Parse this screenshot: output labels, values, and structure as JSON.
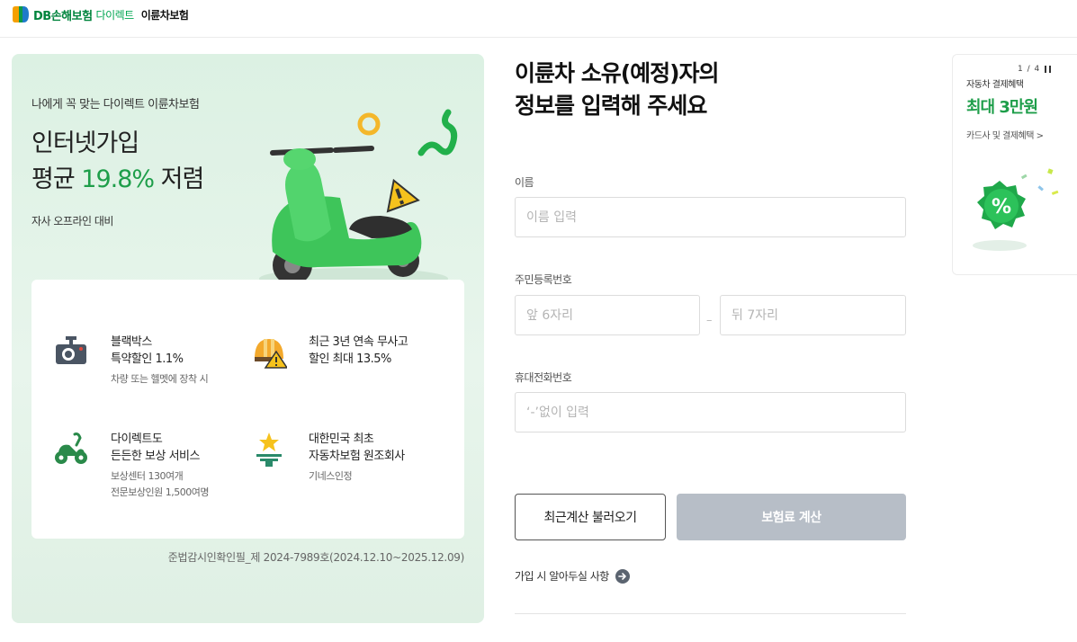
{
  "header": {
    "brand": "DB손해보험",
    "brand_sub": "다이렉트",
    "product": "이륜차보험"
  },
  "promo": {
    "subtitle": "나에게 꼭 맞는 다이렉트 이륜차보험",
    "headline_line1": "인터넷가입",
    "headline_prefix": "평균 ",
    "headline_highlight": "19.8%",
    "headline_suffix": " 저렴",
    "note": "자사 오프라인 대비",
    "benefits": [
      {
        "icon": "blackbox-camera-icon",
        "title1": "블랙박스",
        "title2": "특약할인 1.1%",
        "desc1": "차량 또는 헬멧에 장착 시",
        "desc2": ""
      },
      {
        "icon": "helmet-warning-icon",
        "title1": "최근 3년 연속 무사고",
        "title2": "할인 최대 13.5%",
        "desc1": "",
        "desc2": ""
      },
      {
        "icon": "scooter-icon",
        "title1": "다이렉트도",
        "title2": "든든한 보상 서비스",
        "desc1": "보상센터 130여개",
        "desc2": "전문보상인원 1,500여명"
      },
      {
        "icon": "star-trophy-icon",
        "title1": "대한민국 최초",
        "title2": "자동차보험 원조회사",
        "desc1": "기네스인정",
        "desc2": ""
      }
    ],
    "license": "준법감시인확인필_제 2024-7989호(2024.12.10~2025.12.09)"
  },
  "form": {
    "title_line1": "이륜차 소유(예정)자의",
    "title_line2": "정보를 입력해 주세요",
    "name_label": "이름",
    "name_placeholder": "이름 입력",
    "rrn_label": "주민등록번호",
    "rrn_front_placeholder": "앞 6자리",
    "rrn_separator": "–",
    "rrn_back_placeholder": "뒤 7자리",
    "phone_label": "휴대전화번호",
    "phone_placeholder": "‘-’없이 입력",
    "recent_button": "최근계산 불러오기",
    "calc_button": "보험료 계산",
    "notice": "가입 시 알아두실 사항"
  },
  "banner": {
    "pager": "1 / 4",
    "small": "자동차 결제혜택",
    "big": "최대 3만원",
    "link": "카드사 및 결제혜택 >"
  },
  "colors": {
    "brand_green": "#00843d",
    "accent_green": "#1e9e4a",
    "disabled_button": "#b7bec7",
    "promo_bg": "#dcf1e3"
  }
}
